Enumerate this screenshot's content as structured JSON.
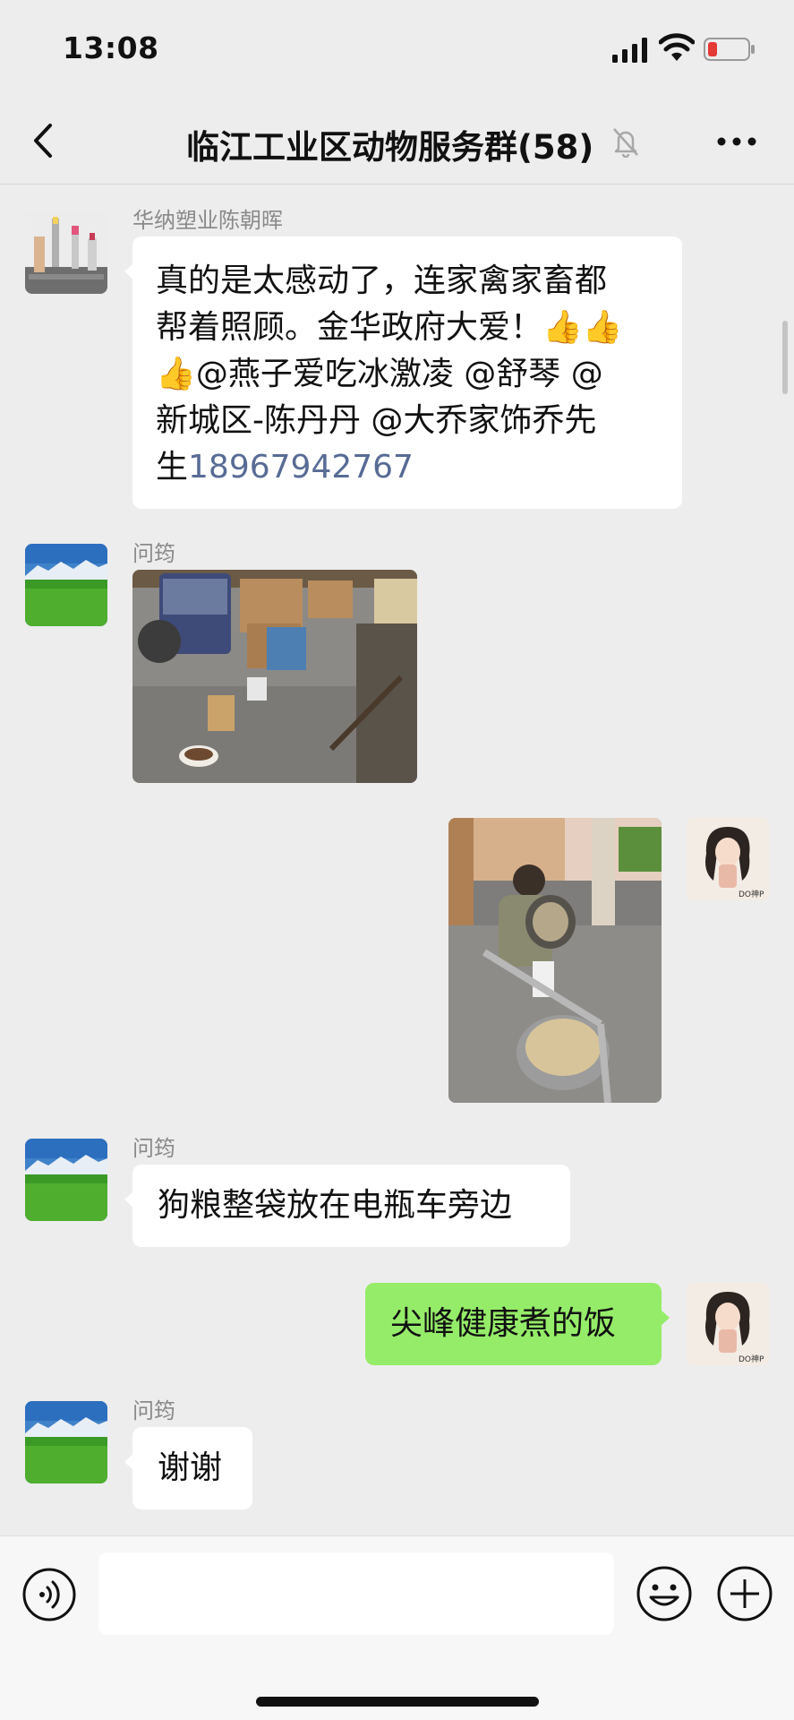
{
  "status_bar": {
    "time": "13:08",
    "battery_color": "#e53935"
  },
  "nav": {
    "title": "临江工业区动物服务群",
    "member_count": "(58)",
    "muted": true
  },
  "messages": [
    {
      "sender": "华纳塑业陈朝晖",
      "text_lines": [
        "真的是太感动了，连家禽家畜都",
        "帮着照顾。金华政府大爱！👍👍",
        "👍@燕子爱吃冰激凌 @舒琴 @",
        "新城区-陈丹丹 @大乔家饰乔先"
      ],
      "text_last_prefix": "生",
      "phone_link": "18967942767"
    },
    {
      "sender": "问筠",
      "image": "warehouse-photo"
    },
    {
      "sender": "",
      "image": "feeding-photo",
      "self": true
    },
    {
      "sender": "问筠",
      "text": "狗粮整袋放在电瓶车旁边"
    },
    {
      "sender": "",
      "text": "尖峰健康煮的饭",
      "self": true
    },
    {
      "sender": "问筠",
      "text": "谢谢"
    }
  ],
  "self_avatar_caption": "DO神P",
  "input": {
    "placeholder": ""
  },
  "colors": {
    "background": "#ededed",
    "self_bubble": "#95ec69",
    "link": "#576b95"
  }
}
